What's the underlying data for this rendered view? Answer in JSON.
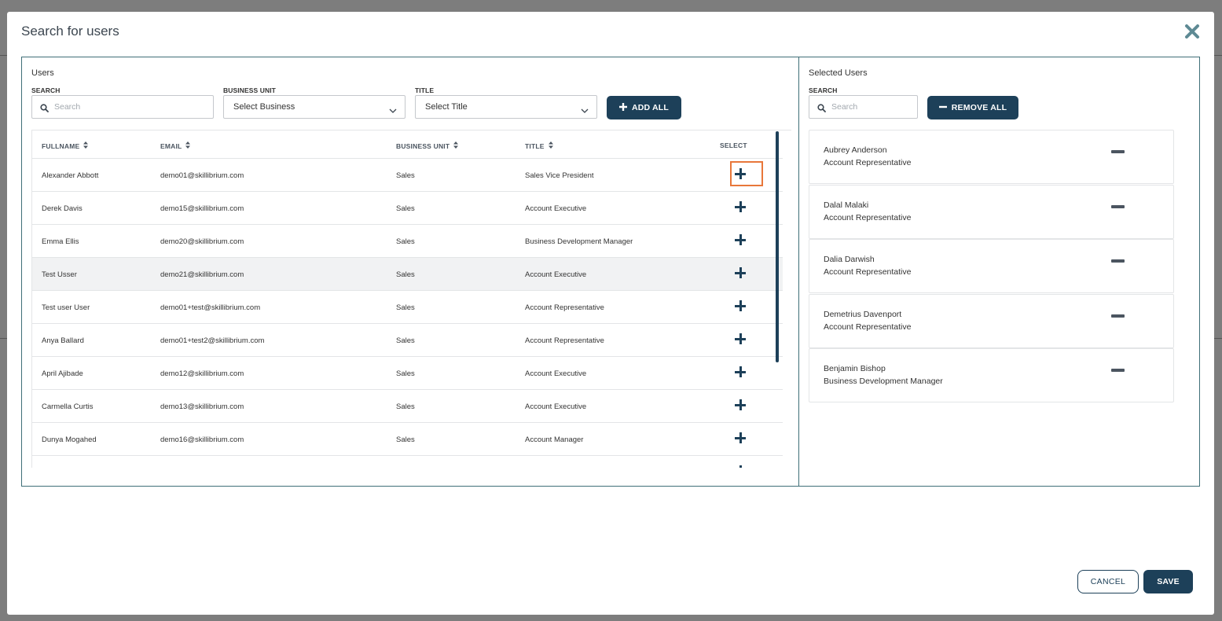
{
  "modal": {
    "title": "Search for users",
    "close_icon": "close-icon"
  },
  "users_panel": {
    "title": "Users",
    "search": {
      "label": "SEARCH",
      "placeholder": "Search"
    },
    "business_unit": {
      "label": "BUSINESS UNIT",
      "value": "Select Business"
    },
    "title_filter": {
      "label": "TITLE",
      "value": "Select Title"
    },
    "add_all_label": "ADD ALL",
    "columns": [
      "FULLNAME",
      "EMAIL",
      "BUSINESS UNIT",
      "TITLE",
      "SELECT"
    ],
    "rows": [
      {
        "fullname": "Alexander Abbott",
        "email": "demo01@skillibrium.com",
        "business_unit": "Sales",
        "title": "Sales Vice President"
      },
      {
        "fullname": "Derek Davis",
        "email": "demo15@skillibrium.com",
        "business_unit": "Sales",
        "title": "Account Executive"
      },
      {
        "fullname": "Emma Ellis",
        "email": "demo20@skillibrium.com",
        "business_unit": "Sales",
        "title": "Business Development Manager"
      },
      {
        "fullname": "Test Usser",
        "email": "demo21@skillibrium.com",
        "business_unit": "Sales",
        "title": "Account Executive"
      },
      {
        "fullname": "Test user User",
        "email": "demo01+test@skillibrium.com",
        "business_unit": "Sales",
        "title": "Account Representative"
      },
      {
        "fullname": "Anya Ballard",
        "email": "demo01+test2@skillibrium.com",
        "business_unit": "Sales",
        "title": "Account Representative"
      },
      {
        "fullname": "April Ajibade",
        "email": "demo12@skillibrium.com",
        "business_unit": "Sales",
        "title": "Account Executive"
      },
      {
        "fullname": "Carmella Curtis",
        "email": "demo13@skillibrium.com",
        "business_unit": "Sales",
        "title": "Account Executive"
      },
      {
        "fullname": "Dunya Mogahed",
        "email": "demo16@skillibrium.com",
        "business_unit": "Sales",
        "title": "Account Manager"
      }
    ]
  },
  "selected_panel": {
    "title": "Selected Users",
    "search": {
      "label": "SEARCH",
      "placeholder": "Search"
    },
    "remove_all_label": "REMOVE ALL",
    "items": [
      {
        "name": "Aubrey Anderson",
        "title": "Account Representative"
      },
      {
        "name": "Dalal Malaki",
        "title": "Account Representative"
      },
      {
        "name": "Dalia Darwish",
        "title": "Account Representative"
      },
      {
        "name": "Demetrius Davenport",
        "title": "Account Representative"
      },
      {
        "name": "Benjamin Bishop",
        "title": "Business Development Manager"
      }
    ]
  },
  "footer": {
    "cancel_label": "CANCEL",
    "save_label": "SAVE"
  },
  "colors": {
    "primary": "#1d4059",
    "border": "#3f6f78",
    "focus": "#e8773a",
    "overlay": "#7d7d7d"
  }
}
